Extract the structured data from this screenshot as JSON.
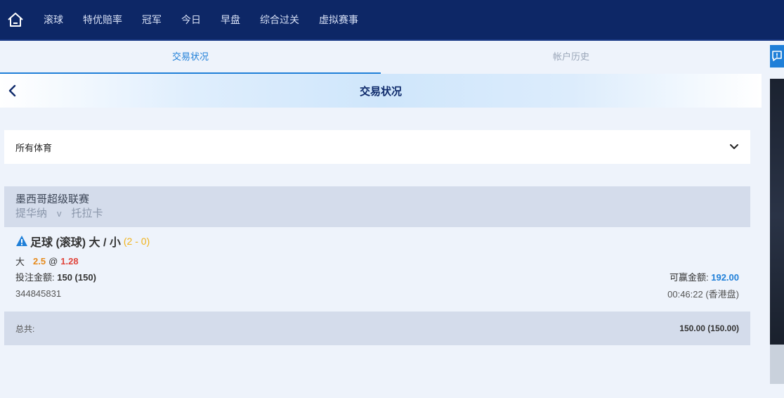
{
  "nav": {
    "items": [
      "滚球",
      "特优赔率",
      "冠军",
      "今日",
      "早盘",
      "综合过关",
      "虚拟赛事"
    ]
  },
  "tabs": {
    "active": "交易状况",
    "history": "帐户历史"
  },
  "header": {
    "title": "交易状况"
  },
  "filter": {
    "selected": "所有体育"
  },
  "bet": {
    "league": "墨西哥超级联赛",
    "home": "提华纳",
    "vs": "v",
    "away": "托拉卡",
    "market": "足球 (滚球) 大 / 小",
    "score": "(2 - 0)",
    "selection": "大",
    "line": "2.5",
    "at": "@",
    "odds": "1.28",
    "stake_label": "投注金额:",
    "stake_value": "150 (150)",
    "win_label": "可赢金额:",
    "win_value": "192.00",
    "ticket_id": "344845831",
    "time": "00:46:22 (香港盘)"
  },
  "total": {
    "label": "总共:",
    "value": "150.00 (150.00)"
  },
  "colors": {
    "nav_bg": "#0d2766",
    "accent": "#1f7fd8",
    "score": "#f1b21a",
    "line": "#e68a1b",
    "odds": "#e0443b"
  }
}
